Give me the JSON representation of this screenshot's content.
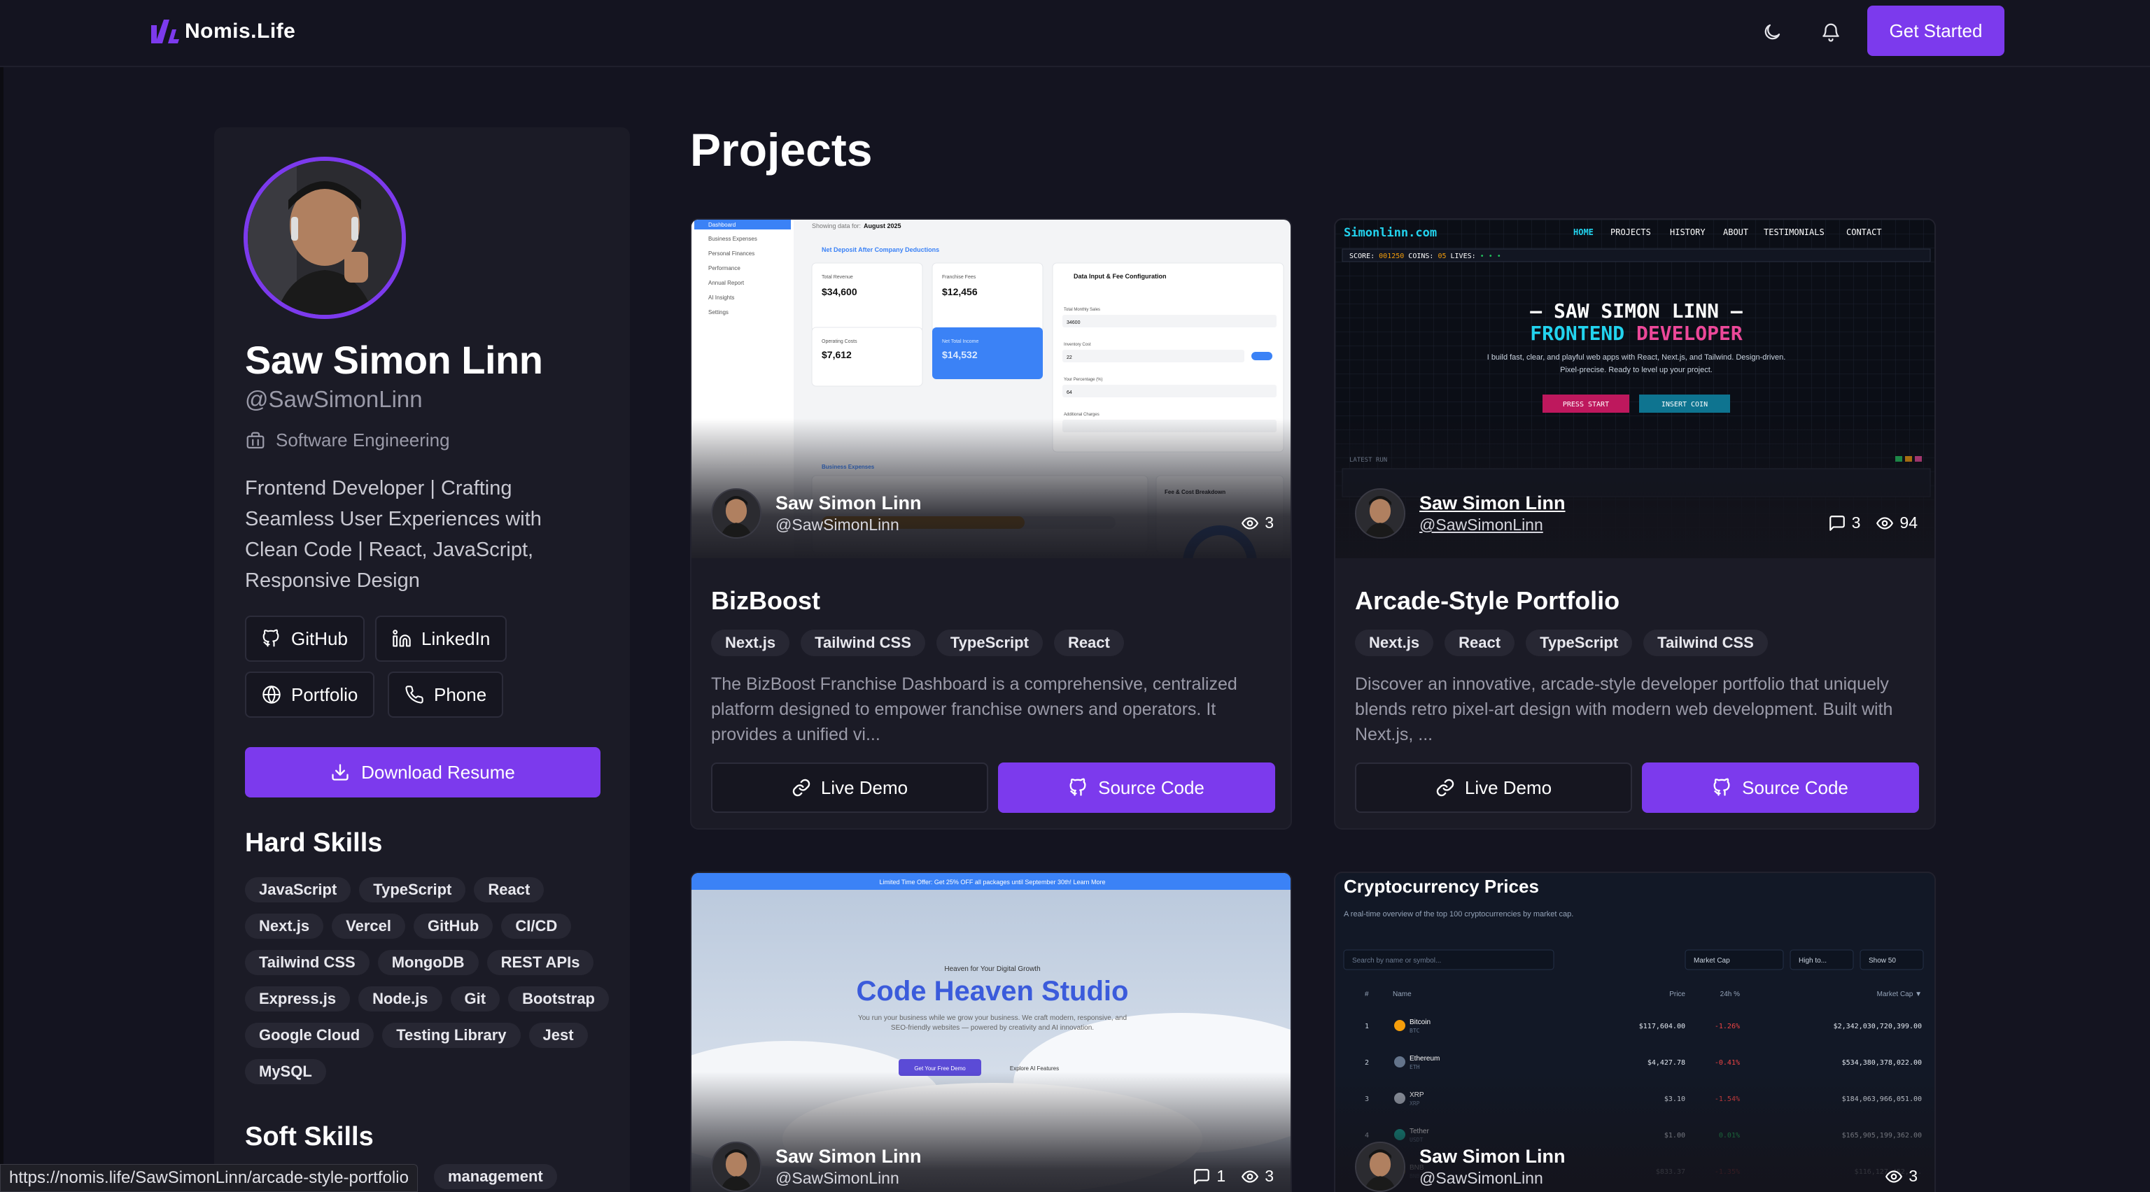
{
  "app": {
    "logo_text": "Nomis.Life",
    "nav_button": "Get Started",
    "icons": [
      "moon-icon",
      "bell-icon"
    ],
    "accent": "#7c3aed"
  },
  "profile": {
    "name": "Saw Simon Linn",
    "handle": "@SawSimonLinn",
    "department": "Software Engineering",
    "bio": "Frontend Developer | Crafting Seamless User Experiences with Clean Code | React, JavaScript, Responsive Design",
    "links": [
      "GitHub",
      "LinkedIn",
      "Portfolio",
      "Phone"
    ],
    "download_label": "Download Resume",
    "hard_skills_title": "Hard Skills",
    "hard_skills": [
      "JavaScript",
      "TypeScript",
      "React",
      "Next.js",
      "Vercel",
      "GitHub",
      "CI/CD",
      "Tailwind CSS",
      "MongoDB",
      "REST APIs",
      "Express.js",
      "Node.js",
      "Git",
      "Bootstrap",
      "Google Cloud",
      "Testing Library",
      "Jest",
      "MySQL"
    ],
    "soft_skills_title": "Soft Skills",
    "soft_skills_visible": "management"
  },
  "projects": {
    "title": "Projects",
    "cards": [
      {
        "title": "BizBoost",
        "author_name": "Saw Simon Linn",
        "author_handle": "@SawSimonLinn",
        "views": "3",
        "tags": [
          "Next.js",
          "Tailwind CSS",
          "TypeScript",
          "React"
        ],
        "description": "The BizBoost Franchise Dashboard is a comprehensive, centralized platform designed to empower franchise owners and operators. It provides a unified vi...",
        "demo_label": "Live Demo",
        "source_label": "Source Code"
      },
      {
        "title": "Arcade-Style Portfolio",
        "author_name": "Saw Simon Linn",
        "author_handle": "@SawSimonLinn",
        "comments": "3",
        "views": "94",
        "tags": [
          "Next.js",
          "React",
          "TypeScript",
          "Tailwind CSS"
        ],
        "description": "Discover an innovative, arcade-style developer portfolio that uniquely blends retro pixel-art design with modern web development. Built with Next.js, ...",
        "demo_label": "Live Demo",
        "source_label": "Source Code"
      },
      {
        "author_name": "Saw Simon Linn",
        "author_handle": "@SawSimonLinn",
        "comments": "1",
        "views": "3"
      },
      {
        "author_name": "Saw Simon Linn",
        "author_handle": "@SawSimonLinn",
        "views": "3"
      }
    ]
  },
  "thumbs": {
    "bizboost": {
      "sidebar": [
        "Dashboard",
        "Business Expenses",
        "Personal Finances",
        "Performance",
        "Annual Report",
        "AI Insights",
        "Settings"
      ],
      "showing": "Showing data for: August 2025",
      "section": "Net Deposit After Company Deductions",
      "kpis": [
        {
          "label": "Total Revenue",
          "value": "$34,600"
        },
        {
          "label": "Franchise Fees",
          "value": "$12,456"
        },
        {
          "label": "Operating Costs",
          "value": "$7,612"
        },
        {
          "label": "Net Total Income",
          "value": "$14,532"
        }
      ],
      "panel_title": "Data Input & Fee Configuration",
      "fields": [
        "Total Monthly Sales",
        "Inventory Cost",
        "Your Percentage (%)",
        "Additional Charges"
      ],
      "field_values": [
        "34600",
        "22",
        "64",
        ""
      ],
      "expenses": "Business Expenses",
      "fee_breakdown": "Fee & Cost Breakdown"
    },
    "arcade": {
      "brand": "Simonlinn.com",
      "menu": [
        "HOME",
        "PROJECTS",
        "HISTORY",
        "ABOUT",
        "TESTIMONIALS",
        "CONTACT"
      ],
      "score": "SCORE: 001250   COINS: 05   LIVES: • • •",
      "headline1": "— SAW SIMON LINN —",
      "headline2a": "FRONTEND",
      "headline2b": "DEVELOPER",
      "tagline": "I build fast, clear, and playful web apps with React, Next.js, and Tailwind. Design-driven. Pixel-precise. Ready to level up your project.",
      "btn1": "PRESS START",
      "btn2": "INSERT COIN",
      "latest": "LATEST RUN"
    },
    "heaven": {
      "banner": "Limited Time Offer: Get 25% OFF all packages until September 30th! Learn More",
      "kicker": "Heaven for Your Digital Growth",
      "title": "Code Heaven Studio",
      "sub": "You run your business while we grow your business. We craft modern, responsive, and SEO-friendly websites — powered by creativity and AI innovation.",
      "cta1": "Get Your Free Demo",
      "cta2": "Explore AI Features"
    },
    "crypto": {
      "title": "Cryptocurrency Prices",
      "subtitle": "A real-time overview of the top 100 cryptocurrencies by market cap.",
      "search": "Search by name or symbol...",
      "sort": "Market Cap",
      "order": "High to...",
      "show": "Show 50",
      "cols": [
        "#",
        "Name",
        "Price",
        "24h %",
        "Market Cap ▼"
      ],
      "rows": [
        {
          "n": "1",
          "name": "Bitcoin",
          "sym": "BTC",
          "price": "$117,604.00",
          "chg": "-1.26%",
          "cap": "$2,342,030,720,399.00"
        },
        {
          "n": "2",
          "name": "Ethereum",
          "sym": "ETH",
          "price": "$4,427.78",
          "chg": "-0.41%",
          "cap": "$534,380,378,022.00"
        },
        {
          "n": "3",
          "name": "XRP",
          "sym": "XRP",
          "price": "$3.10",
          "chg": "-1.54%",
          "cap": "$184,063,966,051.00"
        },
        {
          "n": "4",
          "name": "Tether",
          "sym": "USDT",
          "price": "$1.00",
          "chg": "0.01%",
          "cap": "$165,905,199,362.00"
        },
        {
          "n": "5",
          "name": "BNB",
          "sym": "BNB",
          "price": "$833.37",
          "chg": "-1.35%",
          "cap": "$116,127,452,..."
        }
      ]
    }
  },
  "status_url": "https://nomis.life/SawSimonLinn/arcade-style-portfolio"
}
